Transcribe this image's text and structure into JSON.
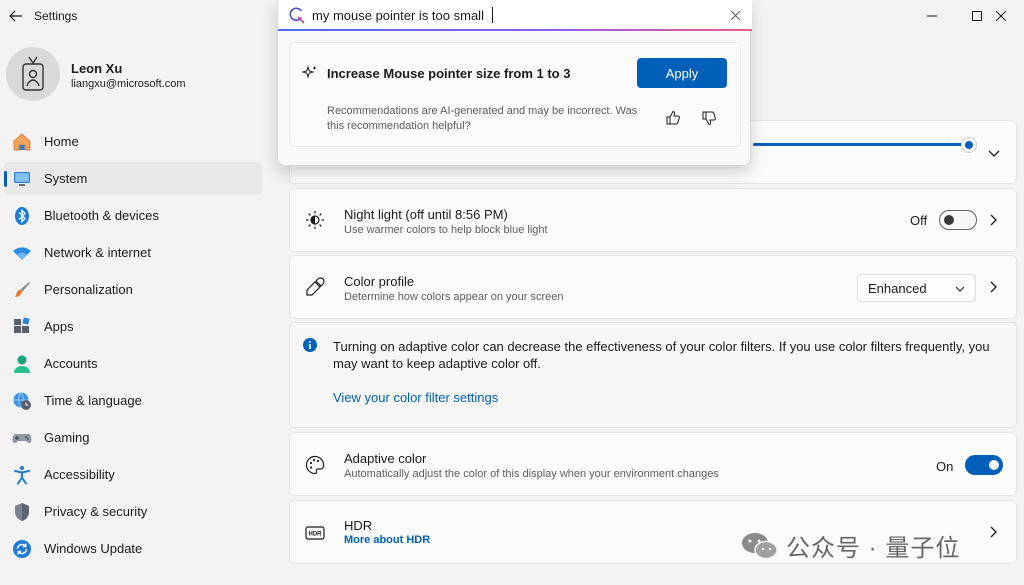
{
  "app": {
    "title": "Settings"
  },
  "profile": {
    "name": "Leon Xu",
    "email": "liangxu@microsoft.com"
  },
  "nav": {
    "items": [
      {
        "label": "Home",
        "icon": "home-icon"
      },
      {
        "label": "System",
        "icon": "system-icon",
        "active": true
      },
      {
        "label": "Bluetooth & devices",
        "icon": "bluetooth-icon"
      },
      {
        "label": "Network & internet",
        "icon": "network-icon"
      },
      {
        "label": "Personalization",
        "icon": "brush-icon"
      },
      {
        "label": "Apps",
        "icon": "apps-icon"
      },
      {
        "label": "Accounts",
        "icon": "accounts-icon"
      },
      {
        "label": "Time & language",
        "icon": "globe-clock-icon"
      },
      {
        "label": "Gaming",
        "icon": "gamepad-icon"
      },
      {
        "label": "Accessibility",
        "icon": "accessibility-icon"
      },
      {
        "label": "Privacy & security",
        "icon": "shield-icon"
      },
      {
        "label": "Windows Update",
        "icon": "update-icon"
      }
    ]
  },
  "search": {
    "value": "my mouse pointer is too small",
    "recommendation": {
      "title": "Increase Mouse pointer size from 1 to 3",
      "apply_label": "Apply",
      "disclaimer": "Recommendations are AI-generated and may be incorrect. Was this recommendation helpful?"
    }
  },
  "brightness": {
    "level": 0.98
  },
  "night_light": {
    "title": "Night light (off until 8:56 PM)",
    "subtitle": "Use warmer colors to help block blue light",
    "state": "Off",
    "on": false
  },
  "color_profile": {
    "title": "Color profile",
    "subtitle": "Determine how colors appear on your screen",
    "value": "Enhanced"
  },
  "info": {
    "text": "Turning on adaptive color can decrease the effectiveness of your color filters. If you use color filters frequently, you may want to keep adaptive color off.",
    "link": "View your color filter settings"
  },
  "adaptive_color": {
    "title": "Adaptive color",
    "subtitle": "Automatically adjust the color of this display when your environment changes",
    "state": "On",
    "on": true
  },
  "hdr": {
    "title": "HDR",
    "link": "More about HDR"
  },
  "watermark": {
    "text": "公众号 · 量子位"
  },
  "colors": {
    "accent": "#005fb8",
    "background": "#f3f3f3",
    "card": "#fbfbfb"
  }
}
